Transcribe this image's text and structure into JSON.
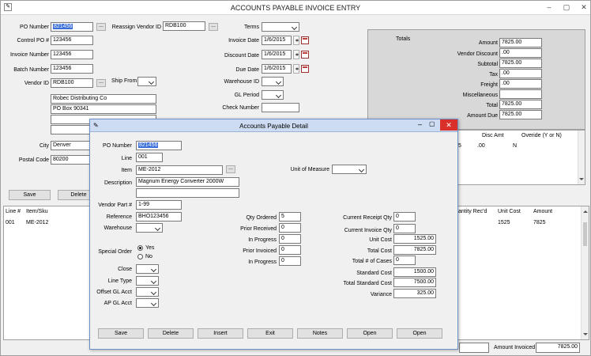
{
  "window": {
    "title": "ACCOUNTS PAYABLE INVOICE ENTRY"
  },
  "main": {
    "po_number": {
      "label": "PO Number",
      "value": "821456"
    },
    "reassign_vendor": {
      "label": "Reassign Vendor ID",
      "value": "RDB100"
    },
    "terms": {
      "label": "Terms"
    },
    "control_po": {
      "label": "Control PO #",
      "value": "123456"
    },
    "invoice_date": {
      "label": "Invoice Date",
      "value": "1/6/2015"
    },
    "invoice_number": {
      "label": "Invoice Number",
      "value": "123456"
    },
    "discount_date": {
      "label": "Discount Date",
      "value": "1/6/2015"
    },
    "batch_number": {
      "label": "Batch Number",
      "value": "123456"
    },
    "due_date": {
      "label": "Due Date",
      "value": "1/6/2015"
    },
    "vendor_id": {
      "label": "Vendor ID",
      "value": "RDB100"
    },
    "ship_from": {
      "label": "Ship From"
    },
    "warehouse_id": {
      "label": "Warehouse ID"
    },
    "gl_period": {
      "label": "GL Period"
    },
    "check_number": {
      "label": "Check Number"
    },
    "address_line1": "Robec Distributing Co",
    "address_line2": "PO Box 90341",
    "city": {
      "label": "City",
      "value": "Denver"
    },
    "postal_code": {
      "label": "Postal Code",
      "value": "80200"
    },
    "save_label": "Save",
    "delete_label": "Delete",
    "ellipsis": "...",
    "totals": {
      "heading": "Totals",
      "amount": {
        "label": "Amount",
        "value": "7825.00"
      },
      "vendor_discount": {
        "label": "Vendor Discount",
        "value": ".00"
      },
      "subtotal": {
        "label": "Subtotal",
        "value": "7825.00"
      },
      "tax": {
        "label": "Tax",
        "value": ".00"
      },
      "freight": {
        "label": "Freight",
        "value": ".00"
      },
      "miscellaneous": {
        "label": "Miscellaneous",
        "value": ""
      },
      "total": {
        "label": "Total",
        "value": "7825.00"
      },
      "amount_due": {
        "label": "Amount Due",
        "value": "7825.00"
      }
    },
    "lines_grid": {
      "headers": [
        "Line #",
        "Item/Sku"
      ],
      "rows": [
        [
          "001",
          "ME-2012"
        ]
      ]
    },
    "right_grid": {
      "headers": [
        "antity Rec'd",
        "Unit Cost",
        "Amount"
      ],
      "rows": [
        [
          "",
          "1525",
          "7825"
        ]
      ]
    },
    "disc_grid": {
      "headers": [
        "Disc Amt",
        "Overide (Y or N)"
      ],
      "row": [
        "5",
        ".00",
        "N"
      ]
    },
    "amount_invoiced": {
      "label": "Amount Invoiced",
      "value": "7825.00"
    }
  },
  "dialog": {
    "title": "Accounts Payable Detail",
    "po_number": {
      "label": "PO Number",
      "value": "821456"
    },
    "line": {
      "label": "Line",
      "value": "001"
    },
    "item": {
      "label": "Item",
      "value": "ME-2012"
    },
    "unit_of_measure": {
      "label": "Unit of Measure"
    },
    "description": {
      "label": "Description",
      "value": "Magnum Energy Converter 2000W",
      "value2": ""
    },
    "vendor_part": {
      "label": "Vendor Part #",
      "value": "1-99"
    },
    "reference": {
      "label": "Reference",
      "value": "BHO123456"
    },
    "warehouse": {
      "label": "Warehouse"
    },
    "special_order": {
      "label": "Special Order",
      "yes": "Yes",
      "no": "No",
      "selected": "Yes"
    },
    "close": {
      "label": "Close"
    },
    "line_type": {
      "label": "Line Type"
    },
    "offset_gl": {
      "label": "Offset GL Acct"
    },
    "ap_gl": {
      "label": "AP GL Acct"
    },
    "qty_ordered": {
      "label": "Qty Ordered",
      "value": "5"
    },
    "prior_received": {
      "label": "Prior Received",
      "value": "0"
    },
    "in_progress1": {
      "label": "In Progress",
      "value": "0"
    },
    "prior_invoiced": {
      "label": "Prior Invoiced",
      "value": "0"
    },
    "in_progress2": {
      "label": "In Progress",
      "value": "0"
    },
    "current_receipt_qty": {
      "label": "Current Receipt Qty",
      "value": "0"
    },
    "current_invoice_qty": {
      "label": "Current Invoice Qty",
      "value": "0"
    },
    "unit_cost": {
      "label": "Unit Cost",
      "value": "1525.00"
    },
    "total_cost": {
      "label": "Total Cost",
      "value": "7825.00"
    },
    "total_cases": {
      "label": "Total # of Cases",
      "value": "0"
    },
    "standard_cost": {
      "label": "Standard Cost",
      "value": "1500.00"
    },
    "total_standard_cost": {
      "label": "Total Standard Cost",
      "value": "7500.00"
    },
    "variance": {
      "label": "Variance",
      "value": "325.00"
    },
    "buttons": [
      "Save",
      "Delete",
      "Insert",
      "Exit",
      "Notes",
      "Open",
      "Open"
    ]
  },
  "colors": {
    "selection": "#3a6fd8",
    "dialog_title": "#cddcf2",
    "close_button": "#d9302a"
  }
}
